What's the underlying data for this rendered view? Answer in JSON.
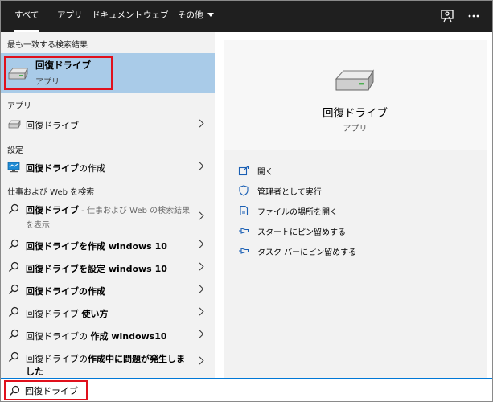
{
  "tabs": [
    {
      "label": "すべて"
    },
    {
      "label": "アプリ"
    },
    {
      "label": "ドキュメント"
    },
    {
      "label": "ウェブ"
    },
    {
      "label": "その他"
    }
  ],
  "left": {
    "best_match_header": "最も一致する検索結果",
    "best_match": {
      "title": "回復ドライブ",
      "subtitle": "アプリ"
    },
    "apps_header": "アプリ",
    "apps_item": "回復ドライブ",
    "settings_header": "設定",
    "settings_item": {
      "bold": "回復ドライブ",
      "rest": "の作成"
    },
    "web_header": "仕事および Web を検索",
    "web_first": {
      "bold": "回復ドライブ",
      "sub1": " - 仕事および Web の検索結果",
      "sub2": "を表示"
    },
    "web_items": [
      {
        "bold": "回復ドライブを作成 windows 10",
        "rest": ""
      },
      {
        "bold": "回復ドライブを設定 windows 10",
        "rest": ""
      },
      {
        "bold": "回復ドライブの作成",
        "rest": ""
      },
      {
        "bold": "使い方",
        "pre": "回復ドライブ "
      },
      {
        "bold": "作成 windows10",
        "pre": "回復ドライブの "
      },
      {
        "bold": "作成中に問題が発生しま",
        "pre": "回復ドライブの",
        "line2": "した"
      }
    ]
  },
  "right": {
    "title": "回復ドライブ",
    "subtitle": "アプリ",
    "actions": [
      {
        "label": "開く",
        "icon": "open-icon"
      },
      {
        "label": "管理者として実行",
        "icon": "shield-icon"
      },
      {
        "label": "ファイルの場所を開く",
        "icon": "file-location-icon"
      },
      {
        "label": "スタートにピン留めする",
        "icon": "pin-icon"
      },
      {
        "label": "タスク バーにピン留めする",
        "icon": "pin-icon"
      }
    ]
  },
  "search": {
    "value": "回復ドライブ"
  }
}
